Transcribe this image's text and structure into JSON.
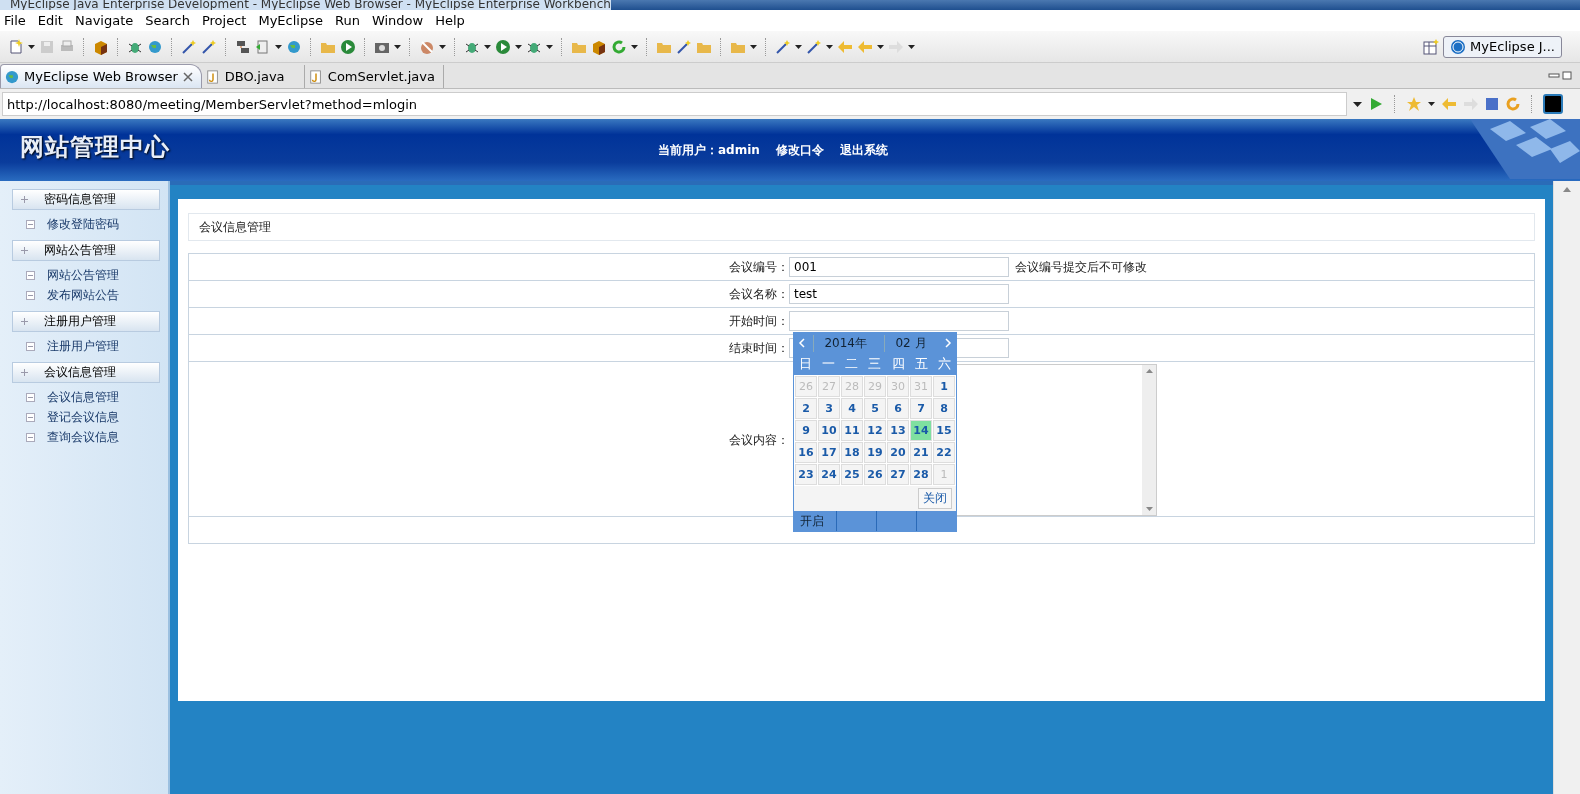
{
  "window": {
    "title": "MyEclipse Java Enterprise Development - MyEclipse Web Browser - MyEclipse Enterprise Workbench"
  },
  "menu": [
    "File",
    "Edit",
    "Navigate",
    "Search",
    "Project",
    "MyEclipse",
    "Run",
    "Window",
    "Help"
  ],
  "perspective": {
    "label": "MyEclipse J..."
  },
  "editor_tabs": [
    {
      "label": "MyEclipse Web Browser",
      "selected": true,
      "kind": "browser"
    },
    {
      "label": "DBO.java",
      "selected": false,
      "kind": "java"
    },
    {
      "label": "ComServlet.java",
      "selected": false,
      "kind": "java"
    }
  ],
  "address_bar": {
    "value": "http://localhost:8080/meeting/MemberServlet?method=mlogin"
  },
  "site": {
    "logo": "网站管理中心",
    "user_label": "当前用户：",
    "user": "admin",
    "links": [
      "修改口令",
      "退出系统"
    ]
  },
  "sidebar": [
    {
      "title": "密码信息管理",
      "items": [
        "修改登陆密码"
      ]
    },
    {
      "title": "网站公告管理",
      "items": [
        "网站公告管理",
        "发布网站公告"
      ]
    },
    {
      "title": "注册用户管理",
      "items": [
        "注册用户管理"
      ]
    },
    {
      "title": "会议信息管理",
      "items": [
        "会议信息管理",
        "登记会议信息",
        "查询会议信息"
      ]
    }
  ],
  "page_title": "会议信息管理",
  "form": {
    "rows": [
      {
        "kind": "text",
        "label": "会议编号：",
        "value": "001",
        "note": "会议编号提交后不可修改"
      },
      {
        "kind": "text",
        "label": "会议名称：",
        "value": "test"
      },
      {
        "kind": "text",
        "label": "开始时间："
      },
      {
        "kind": "text",
        "label": "结束时间："
      },
      {
        "kind": "textarea",
        "label": "会议内容："
      },
      {
        "kind": "empty"
      }
    ]
  },
  "calendar": {
    "year": "2014年",
    "month": "02 月",
    "weekdays": [
      "日",
      "一",
      "二",
      "三",
      "四",
      "五",
      "六"
    ],
    "weeks": [
      [
        {
          "day": "26",
          "other_month": true,
          "selected": false
        },
        {
          "day": "27",
          "other_month": true,
          "selected": false
        },
        {
          "day": "28",
          "other_month": true,
          "selected": false
        },
        {
          "day": "29",
          "other_month": true,
          "selected": false
        },
        {
          "day": "30",
          "other_month": true,
          "selected": false
        },
        {
          "day": "31",
          "other_month": true,
          "selected": false
        },
        {
          "day": "1",
          "other_month": false,
          "selected": false
        }
      ],
      [
        {
          "day": "2",
          "other_month": false,
          "selected": false
        },
        {
          "day": "3",
          "other_month": false,
          "selected": false
        },
        {
          "day": "4",
          "other_month": false,
          "selected": false
        },
        {
          "day": "5",
          "other_month": false,
          "selected": false
        },
        {
          "day": "6",
          "other_month": false,
          "selected": false
        },
        {
          "day": "7",
          "other_month": false,
          "selected": false
        },
        {
          "day": "8",
          "other_month": false,
          "selected": false
        }
      ],
      [
        {
          "day": "9",
          "other_month": false,
          "selected": false
        },
        {
          "day": "10",
          "other_month": false,
          "selected": false
        },
        {
          "day": "11",
          "other_month": false,
          "selected": false
        },
        {
          "day": "12",
          "other_month": false,
          "selected": false
        },
        {
          "day": "13",
          "other_month": false,
          "selected": false
        },
        {
          "day": "14",
          "other_month": false,
          "selected": true
        },
        {
          "day": "15",
          "other_month": false,
          "selected": false
        }
      ],
      [
        {
          "day": "16",
          "other_month": false,
          "selected": false
        },
        {
          "day": "17",
          "other_month": false,
          "selected": false
        },
        {
          "day": "18",
          "other_month": false,
          "selected": false
        },
        {
          "day": "19",
          "other_month": false,
          "selected": false
        },
        {
          "day": "20",
          "other_month": false,
          "selected": false
        },
        {
          "day": "21",
          "other_month": false,
          "selected": false
        },
        {
          "day": "22",
          "other_month": false,
          "selected": false
        }
      ],
      [
        {
          "day": "23",
          "other_month": false,
          "selected": false
        },
        {
          "day": "24",
          "other_month": false,
          "selected": false
        },
        {
          "day": "25",
          "other_month": false,
          "selected": false
        },
        {
          "day": "26",
          "other_month": false,
          "selected": false
        },
        {
          "day": "27",
          "other_month": false,
          "selected": false
        },
        {
          "day": "28",
          "other_month": false,
          "selected": false
        },
        {
          "day": "1",
          "other_month": true,
          "selected": false
        }
      ]
    ],
    "close": "关闭",
    "time_toggle": "开启"
  }
}
